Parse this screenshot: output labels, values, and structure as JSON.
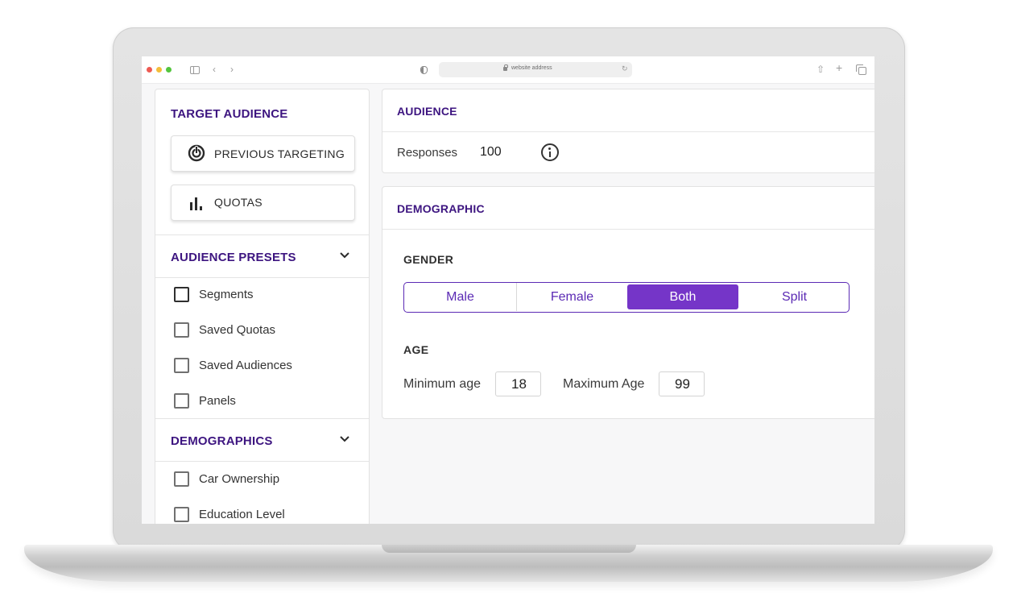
{
  "browser": {
    "address": "website address",
    "icons": [
      "sidebar-icon",
      "back-icon",
      "forward-icon",
      "shield-icon",
      "lock-icon",
      "reload-icon",
      "share-icon",
      "new-tab-icon",
      "tabs-icon"
    ]
  },
  "sidebar": {
    "title": "TARGET AUDIENCE",
    "buttons": [
      {
        "label": "PREVIOUS TARGETING",
        "icon": "target-icon"
      },
      {
        "label": "QUOTAS",
        "icon": "bar-chart-icon"
      }
    ],
    "sections": [
      {
        "title": "AUDIENCE PRESETS",
        "icon": "chevron-down-icon",
        "items": [
          {
            "label": "Segments",
            "checked": false
          },
          {
            "label": "Saved Quotas",
            "checked": false
          },
          {
            "label": "Saved Audiences",
            "checked": false
          },
          {
            "label": "Panels",
            "checked": false
          }
        ]
      },
      {
        "title": "DEMOGRAPHICS",
        "icon": "chevron-down-icon",
        "items": [
          {
            "label": "Car Ownership",
            "checked": false
          },
          {
            "label": "Education Level",
            "checked": false
          }
        ]
      }
    ]
  },
  "audience": {
    "title": "AUDIENCE",
    "responses_label": "Responses",
    "responses_value": "100",
    "info_icon": "info-icon"
  },
  "demographic": {
    "title": "DEMOGRAPHIC",
    "gender": {
      "title": "GENDER",
      "options": [
        "Male",
        "Female",
        "Both",
        "Split"
      ],
      "selected": "Both"
    },
    "age": {
      "title": "AGE",
      "min_label": "Minimum age",
      "min_value": "18",
      "max_label": "Maximum Age",
      "max_value": "99"
    }
  },
  "colors": {
    "accent": "#7535c8",
    "heading": "#3d1580",
    "border": "#5b2ab4"
  }
}
